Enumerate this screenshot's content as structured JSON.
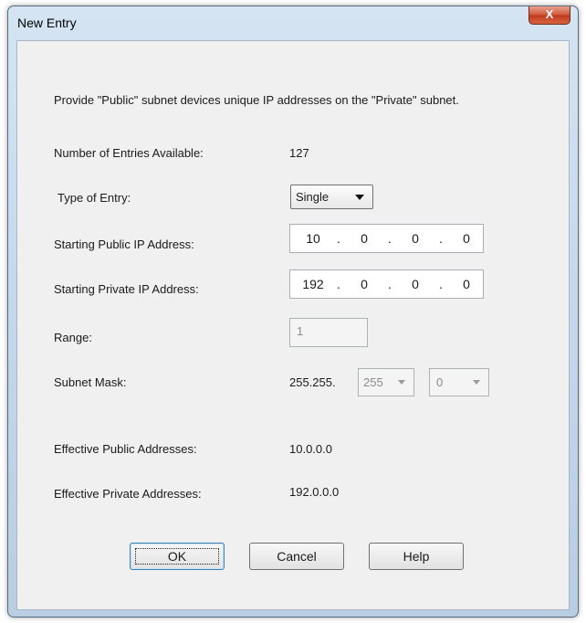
{
  "window": {
    "title": "New Entry",
    "close_glyph": "X"
  },
  "description": "Provide \"Public\" subnet devices unique IP addresses on the \"Private\" subnet.",
  "fields": {
    "entries_available": {
      "label": "Number of Entries Available:",
      "value": "127"
    },
    "type_of_entry": {
      "label": "Type of Entry:",
      "selected": "Single"
    },
    "start_public_ip": {
      "label": "Starting Public IP Address:",
      "octets": [
        "10",
        "0",
        "0",
        "0"
      ]
    },
    "start_private_ip": {
      "label": "Starting Private IP Address:",
      "octets": [
        "192",
        "0",
        "0",
        "0"
      ]
    },
    "range": {
      "label": "Range:",
      "value": "1"
    },
    "subnet_mask": {
      "label": "Subnet Mask:",
      "prefix": "255.255.",
      "third": "255",
      "fourth": "0"
    },
    "effective_public": {
      "label": "Effective Public Addresses:",
      "value": "10.0.0.0"
    },
    "effective_private": {
      "label": "Effective Private Addresses:",
      "value": "192.0.0.0"
    }
  },
  "buttons": {
    "ok": "OK",
    "cancel": "Cancel",
    "help": "Help"
  },
  "icons": {
    "close": "close-icon",
    "dropdown": "chevron-down-icon"
  }
}
